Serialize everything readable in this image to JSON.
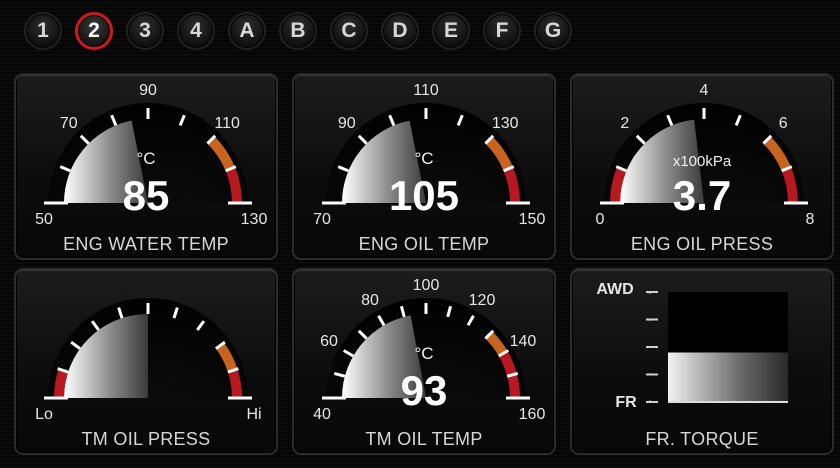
{
  "pages": [
    "1",
    "2",
    "3",
    "4",
    "A",
    "B",
    "C",
    "D",
    "E",
    "F",
    "G"
  ],
  "active_page": "2",
  "colors": {
    "red": "#b81820",
    "orange": "#c8641e",
    "tick": "#ffffff",
    "active_ring": "#d01818"
  },
  "gauges": [
    {
      "id": "eng-water-temp",
      "title": "ENG WATER TEMP",
      "unit": "°C",
      "value_text": "85",
      "value": 85,
      "min": 50,
      "max": 130,
      "labels": [
        "50",
        "70",
        "90",
        "110",
        "130"
      ],
      "ticks": 9,
      "orange_from": 110,
      "red_from": 120
    },
    {
      "id": "eng-oil-temp",
      "title": "ENG OIL TEMP",
      "unit": "°C",
      "value_text": "105",
      "value": 105,
      "min": 70,
      "max": 150,
      "labels": [
        "70",
        "90",
        "110",
        "130",
        "150"
      ],
      "ticks": 9,
      "orange_from": 130,
      "red_from": 140
    },
    {
      "id": "eng-oil-press",
      "title": "ENG OIL PRESS",
      "unit": "x100kPa",
      "value_text": "3.7",
      "value": 3.7,
      "min": 0,
      "max": 8,
      "labels": [
        "0",
        "2",
        "4",
        "6",
        "8"
      ],
      "ticks": 9,
      "low_red_to": 1,
      "orange_from": 6,
      "red_from": 7
    },
    {
      "id": "tm-oil-press",
      "title": "TM OIL PRESS",
      "unit": "",
      "value_text": "",
      "value": 0.5,
      "min": 0,
      "max": 1,
      "labels": [
        "Lo",
        "",
        "",
        "",
        "Hi"
      ],
      "ticks": 11,
      "low_red_to": 0.1,
      "orange_from": 0.8,
      "red_from": 0.9
    },
    {
      "id": "tm-oil-temp",
      "title": "TM OIL TEMP",
      "unit": "°C",
      "value_text": "93",
      "value": 93,
      "min": 40,
      "max": 160,
      "labels": [
        "40",
        "60",
        "80",
        "100",
        "120",
        "140",
        "160"
      ],
      "ticks": 13,
      "orange_from": 130,
      "red_from": 140
    }
  ],
  "torque": {
    "title": "FR. TORQUE",
    "top_label": "AWD",
    "bottom_label": "FR",
    "level": 0.45
  }
}
